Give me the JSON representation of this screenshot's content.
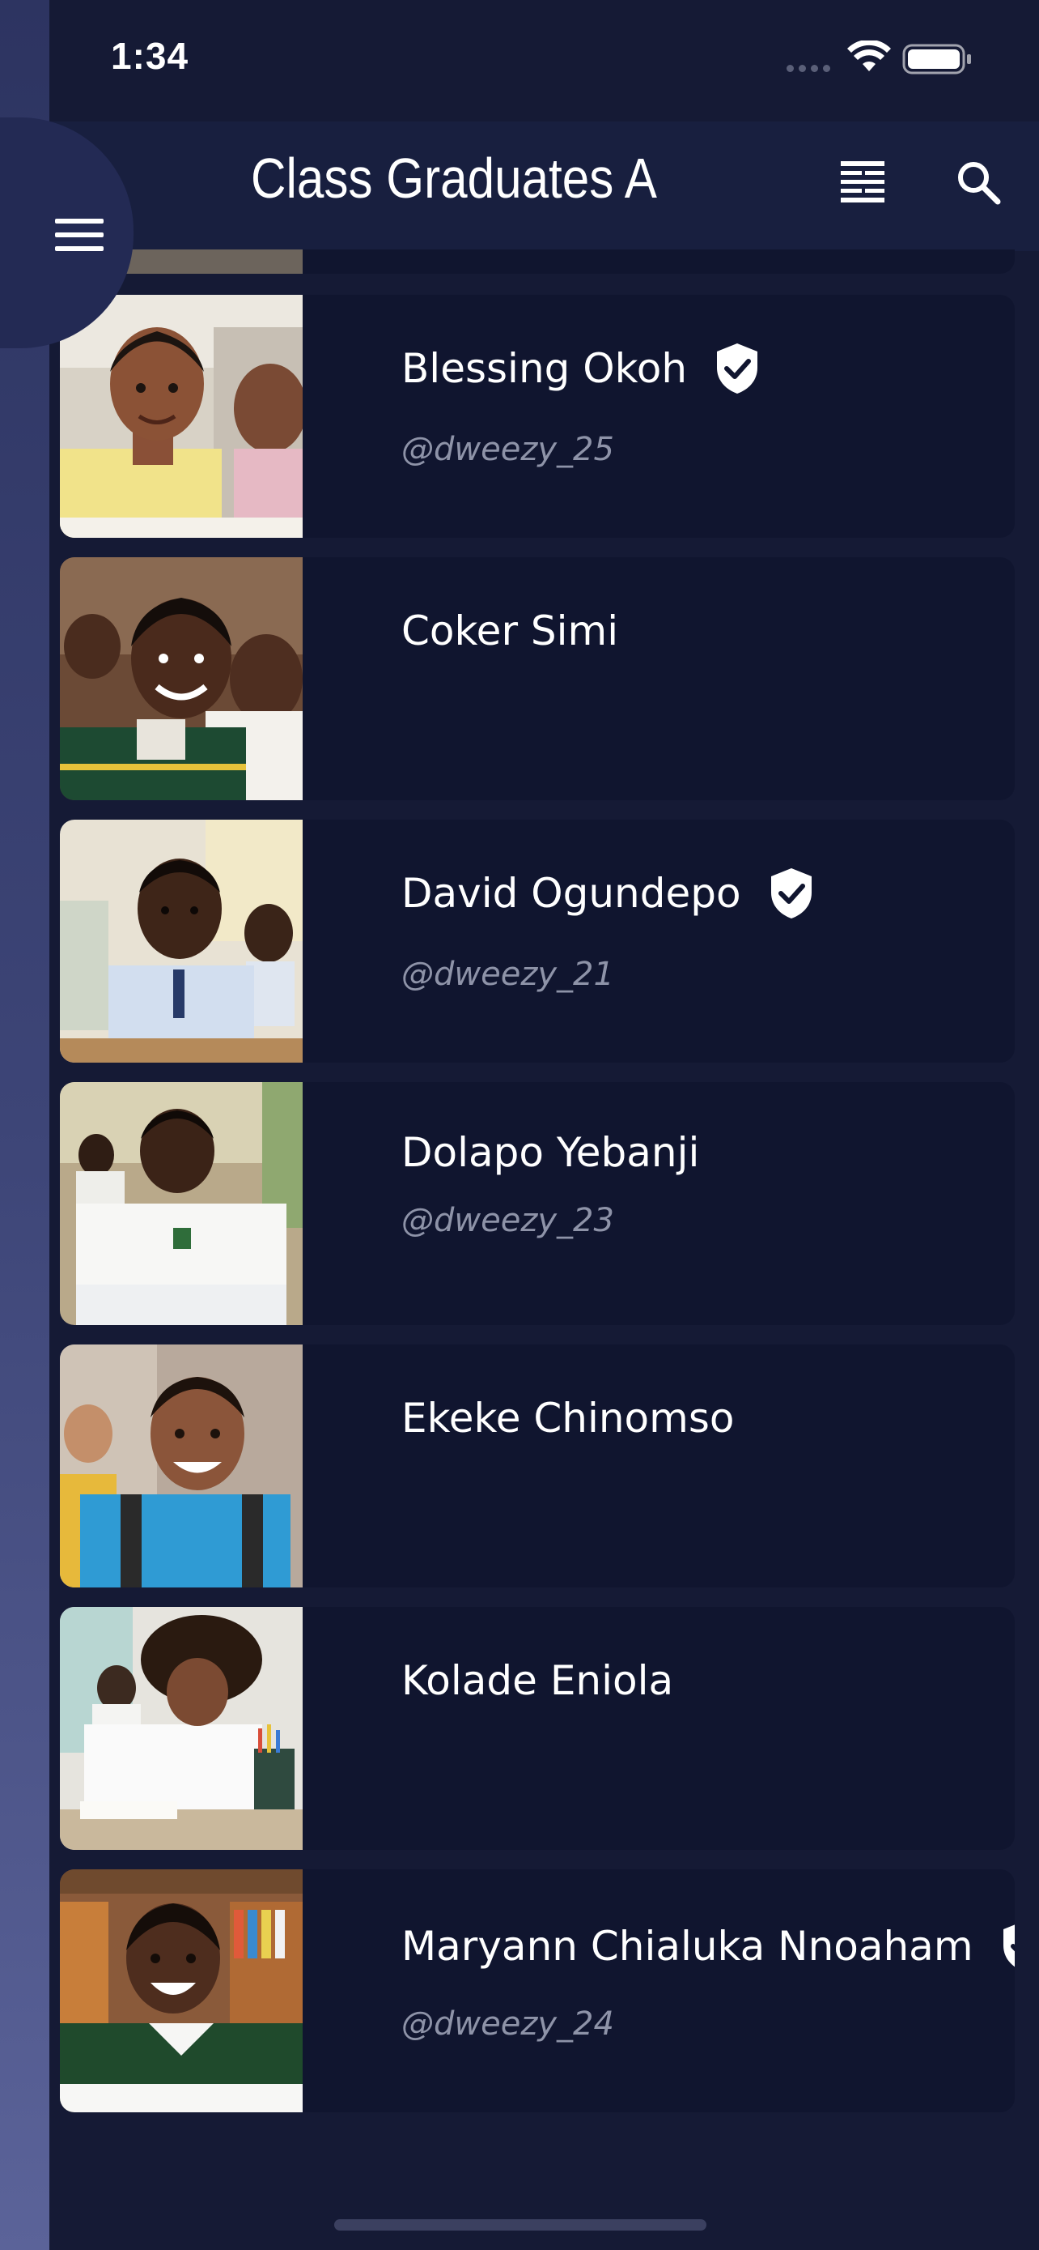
{
  "status_bar": {
    "time": "1:34"
  },
  "header": {
    "title": "Class Graduates A"
  },
  "students": [
    {
      "name": "Blessing Okoh",
      "handle": "@dweezy_25",
      "verified": true
    },
    {
      "name": "Coker Simi",
      "handle": "",
      "verified": false
    },
    {
      "name": "David Ogundepo",
      "handle": "@dweezy_21",
      "verified": true
    },
    {
      "name": "Dolapo Yebanji",
      "handle": "@dweezy_23",
      "verified": false
    },
    {
      "name": "Ekeke Chinomso",
      "handle": "",
      "verified": false
    },
    {
      "name": "Kolade Eniola",
      "handle": "",
      "verified": false
    },
    {
      "name": "Maryann Chialuka Nnoaham",
      "handle": "@dweezy_24",
      "verified": true
    }
  ],
  "icons": {
    "menu": "menu-icon",
    "list_view": "list-view-icon",
    "search": "search-icon",
    "verified": "verified-shield-icon"
  },
  "colors": {
    "background": "#151a35",
    "card": "#10152f",
    "header": "#181f3f",
    "handle_text": "#8e93a8"
  }
}
